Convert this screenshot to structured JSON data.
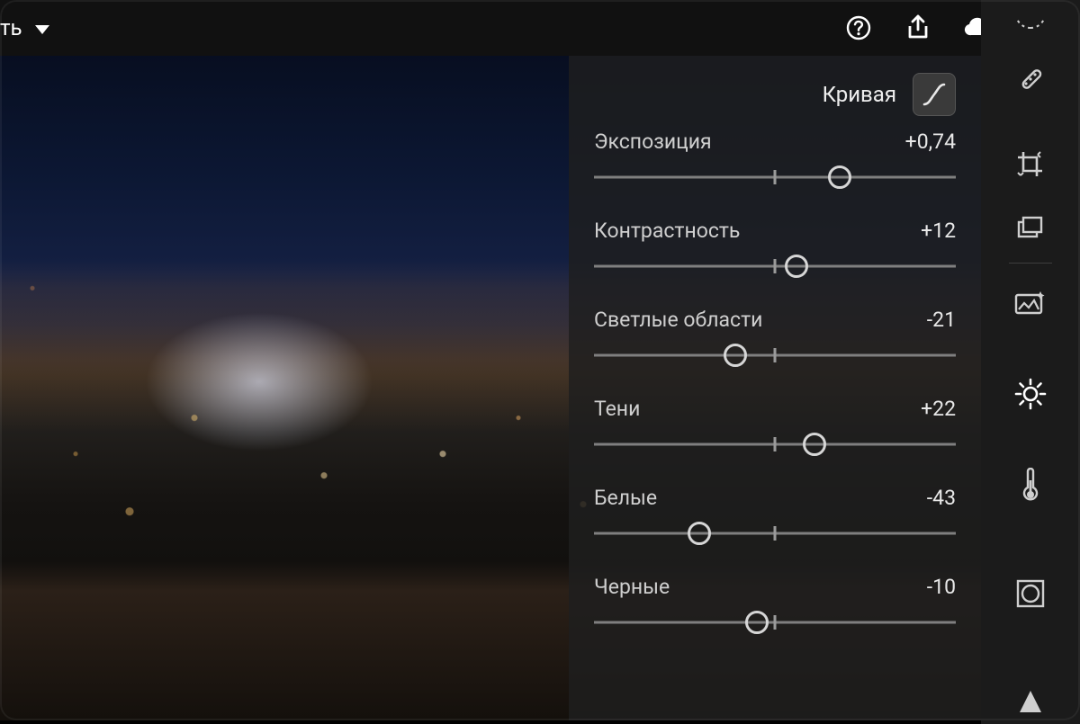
{
  "topbar": {
    "title_fragment": "ть",
    "icons": {
      "help": "help-icon",
      "share": "share-icon",
      "cloud": "cloud-sync-icon",
      "more": "more-icon"
    }
  },
  "panel": {
    "curve_label": "Кривая",
    "sliders": [
      {
        "label": "Экспозиция",
        "value": "+0,74",
        "pct": 68
      },
      {
        "label": "Контрастность",
        "value": "+12",
        "pct": 56
      },
      {
        "label": "Светлые области",
        "value": "-21",
        "pct": 39
      },
      {
        "label": "Тени",
        "value": "+22",
        "pct": 61
      },
      {
        "label": "Белые",
        "value": "-43",
        "pct": 29
      },
      {
        "label": "Черные",
        "value": "-10",
        "pct": 45
      }
    ]
  },
  "toolstrip": {
    "tools": [
      {
        "name": "color-wheel-icon"
      },
      {
        "name": "healing-brush-icon"
      },
      {
        "name": "crop-icon"
      },
      {
        "name": "presets-icon"
      },
      {
        "name": "auto-enhance-icon"
      },
      {
        "name": "light-icon",
        "active": true
      },
      {
        "name": "color-temp-icon"
      },
      {
        "name": "vignette-icon"
      },
      {
        "name": "sharpen-icon"
      }
    ]
  }
}
